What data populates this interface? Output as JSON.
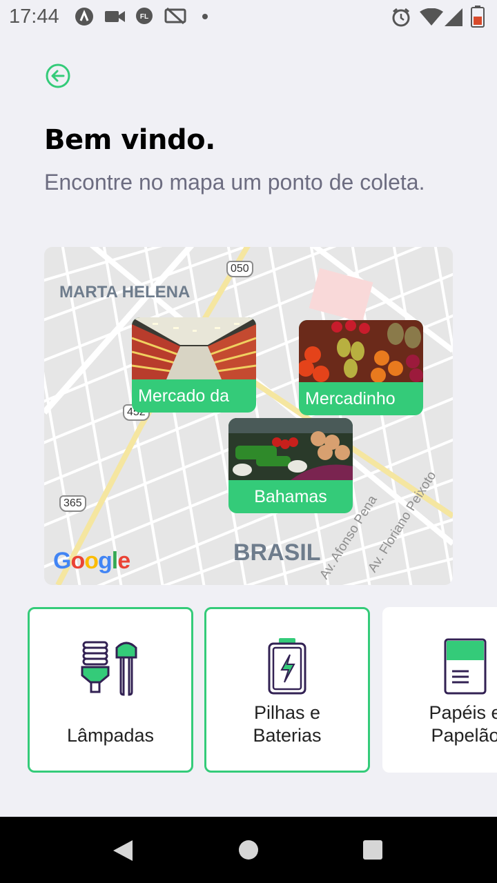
{
  "status": {
    "time": "17:44"
  },
  "header": {
    "back_icon": "arrow-left-circle-icon",
    "title": "Bem vindo.",
    "subtitle": "Encontre no mapa um ponto de coleta."
  },
  "map": {
    "labels": {
      "neighborhood": "MARTA HELENA",
      "city": "BRASIL",
      "street1": "Av. Afonso Pena",
      "street2": "Av. Floriano Peixoto",
      "shield1": "050",
      "shield2": "452",
      "shield3": "365",
      "provider": "Google"
    },
    "markers": [
      {
        "name": "Mercado da"
      },
      {
        "name": "Mercadinho"
      },
      {
        "name": "Bahamas"
      }
    ]
  },
  "items": [
    {
      "label": "Lâmpadas",
      "icon": "lamp-icon",
      "selected": true
    },
    {
      "label": "Pilhas e Baterias",
      "icon": "battery-icon",
      "selected": true
    },
    {
      "label": "Papéis e Papelão",
      "icon": "paper-icon",
      "selected": false
    }
  ],
  "colors": {
    "accent": "#34cb79",
    "background": "#f0f0f5",
    "subtitle": "#6c6c80"
  }
}
